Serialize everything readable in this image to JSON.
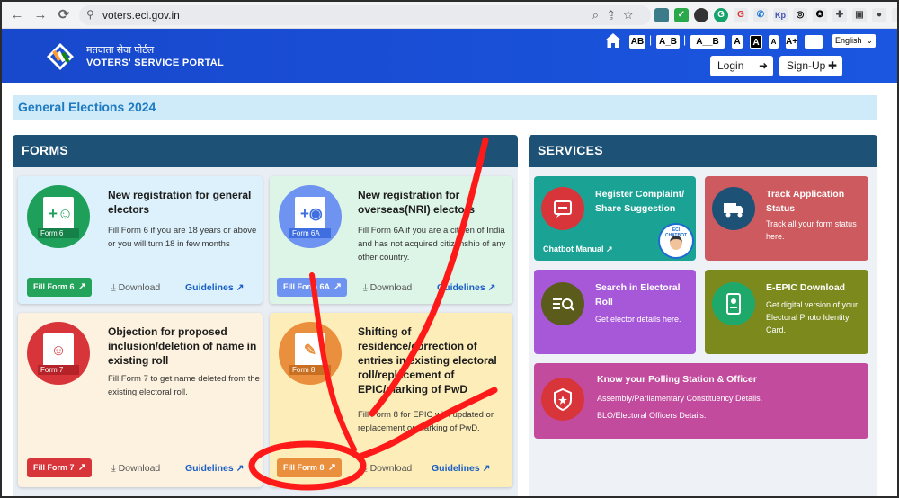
{
  "browser": {
    "url": "voters.eci.gov.in",
    "back_label": "←",
    "forward_label": "→",
    "reload_label": "⟳"
  },
  "header": {
    "hindi_name": "मतदाता सेवा पोर्टल",
    "english_name": "VOTERS' SERVICE PORTAL",
    "a11y": [
      "AB",
      "A_B",
      "A__B",
      "A",
      "A",
      "A",
      "A+"
    ],
    "separator": "|",
    "language": "English",
    "login_label": "Login",
    "signup_label": "Sign-Up"
  },
  "banner": {
    "title": "General Elections 2024"
  },
  "forms": {
    "heading": "FORMS",
    "cards": [
      {
        "title": "New registration for general electors",
        "description": "Fill Form 6 if you are 18 years or above or you will turn 18 in few months",
        "tag": "Form 6",
        "button": "Fill Form 6",
        "download": "Download",
        "guidelines": "Guidelines"
      },
      {
        "title": "New registration for overseas(NRI) electors",
        "description": "Fill Form 6A if you are a citizen of India and has not acquired citizenship of any other country.",
        "tag": "Form 6A",
        "button": "Fill Form 6A",
        "download": "Download",
        "guidelines": "Guidelines"
      },
      {
        "title": "Objection for proposed inclusion/deletion of name in existing roll",
        "description": "Fill Form 7 to get name deleted from the existing electoral roll.",
        "tag": "Form 7",
        "button": "Fill Form 7",
        "download": "Download",
        "guidelines": "Guidelines"
      },
      {
        "title": "Shifting of residence/correction of entries in existing electoral roll/replacement of EPIC/marking of PwD",
        "description": "Fill Form 8 for EPIC with updated or replacement or marking of PwD.",
        "tag": "Form 8",
        "button": "Fill Form 8",
        "download": "Download",
        "guidelines": "Guidelines"
      }
    ]
  },
  "services": {
    "heading": "SERVICES",
    "cards": [
      {
        "title": "Register Complaint/ Share Suggestion",
        "link": "Chatbot Manual",
        "badge": "ECI CHATBOT"
      },
      {
        "title": "Track Application Status",
        "description": "Track all your form status here."
      },
      {
        "title": "Search in Electoral Roll",
        "description": "Get elector details here."
      },
      {
        "title": "E-EPIC Download",
        "description": "Get digital version of your Electoral Photo Identity Card."
      },
      {
        "title": "Know your Polling Station & Officer",
        "lines": [
          "Assembly/Parliamentary Constituency Details.",
          "BLO/Electoral Officers Details."
        ]
      }
    ]
  },
  "colors": {
    "header_bg": "#1a4fd0",
    "panel_head": "#1d5276",
    "annotation": "#ff1a1a"
  }
}
